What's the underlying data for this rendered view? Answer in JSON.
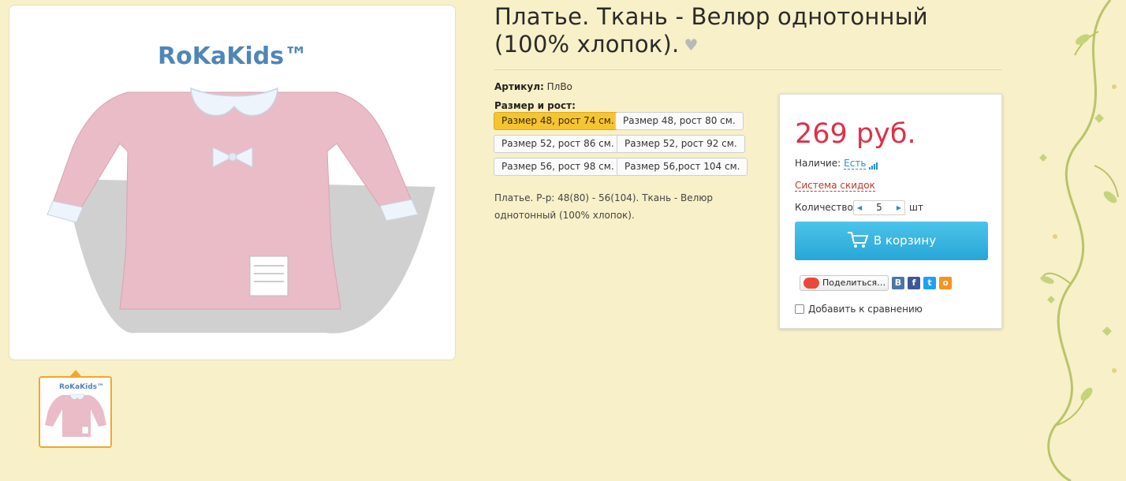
{
  "product": {
    "title": "Платье. Ткань - Велюр однотонный (100% хлопок).",
    "sku_label": "Артикул:",
    "sku_value": "ПлВо",
    "size_label": "Размер и рост:",
    "sizes": [
      {
        "label": "Размер 48, рост 74 см.",
        "selected": true
      },
      {
        "label": "Размер 48, рост 80 см.",
        "selected": false
      },
      {
        "label": "Размер 52, рост 86 см.",
        "selected": false
      },
      {
        "label": "Размер 52, рост 92 см.",
        "selected": false
      },
      {
        "label": "Размер 56, рост 98 см.",
        "selected": false
      },
      {
        "label": "Размер 56,рост 104 см.",
        "selected": false
      }
    ],
    "description": "Платье. Р-р: 48(80) - 56(104). Ткань - Велюр однотонный (100% хлопок).",
    "brand_logo": "RoKaKids™"
  },
  "buy_box": {
    "price": "269 руб.",
    "stock_label": "Наличие:",
    "stock_value": "Есть",
    "discount_link": "Система скидок",
    "qty_label": "Количество:",
    "qty_value": "5",
    "qty_unit": "шт",
    "cart_button": "В корзину",
    "share_button": "Поделиться…",
    "compare_label": "Добавить к сравнению"
  },
  "colors": {
    "price": "#e0304a",
    "cart_button": "#2ea9d8",
    "selected_size": "#f5c432",
    "thumb_border": "#f5a623"
  },
  "icons": [
    "heart-icon",
    "cart-icon",
    "stock-bars-icon",
    "vk-icon",
    "facebook-icon",
    "twitter-icon",
    "odnoklassniki-icon",
    "share-icon"
  ]
}
